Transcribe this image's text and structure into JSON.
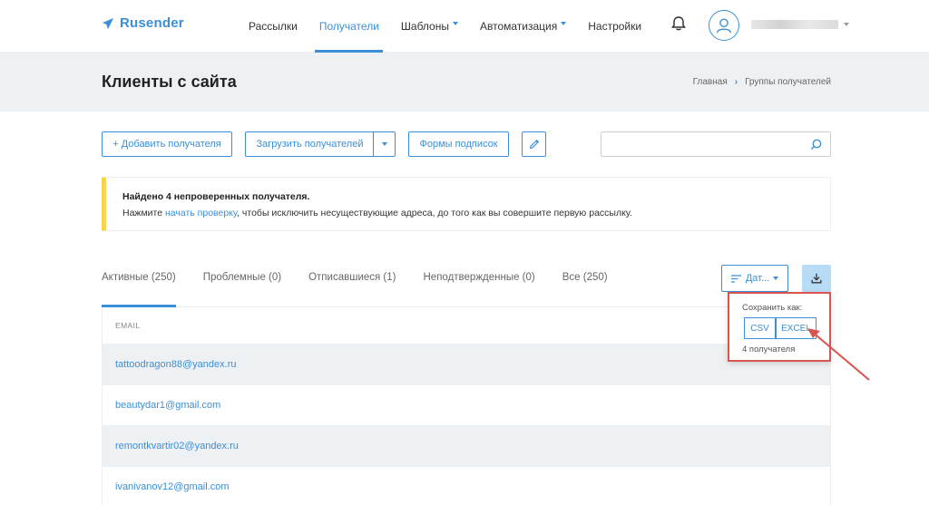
{
  "brand": {
    "name": "Rusender",
    "accent": "#3b8fd9"
  },
  "nav": {
    "items": [
      {
        "label": "Рассылки",
        "active": false,
        "dropdown": false
      },
      {
        "label": "Получатели",
        "active": true,
        "dropdown": false
      },
      {
        "label": "Шаблоны",
        "active": false,
        "dropdown": true
      },
      {
        "label": "Автоматизация",
        "active": false,
        "dropdown": true
      },
      {
        "label": "Настройки",
        "active": false,
        "dropdown": false
      }
    ]
  },
  "header": {
    "title": "Клиенты с сайта",
    "breadcrumb": [
      "Главная",
      "Группы получателей"
    ]
  },
  "toolbar": {
    "add_label": "+ Добавить получателя",
    "upload_label": "Загрузить получателей",
    "forms_label": "Формы подписок",
    "search_placeholder": ""
  },
  "notice": {
    "title": "Найдено 4 непроверенных получателя.",
    "text_before": "Нажмите ",
    "link_text": "начать проверку",
    "text_after": ", чтобы исключить несуществующие адреса, до того как вы совершите первую рассылку.",
    "color": "#f9d34c"
  },
  "tabs": [
    {
      "label": "Активные (250)",
      "active": true
    },
    {
      "label": "Проблемные (0)",
      "active": false
    },
    {
      "label": "Отписавшиеся (1)",
      "active": false
    },
    {
      "label": "Неподтвержденные (0)",
      "active": false
    },
    {
      "label": "Все (250)",
      "active": false
    }
  ],
  "sort": {
    "label": "Дат..."
  },
  "table": {
    "column_header": "EMAIL",
    "rows": [
      "tattoodragon88@yandex.ru",
      "beautydar1@gmail.com",
      "remontkvartir02@yandex.ru",
      "ivanivanov12@gmail.com"
    ]
  },
  "export_popup": {
    "title": "Сохранить как:",
    "csv": "CSV",
    "excel": "EXCEL",
    "count": "4 получателя",
    "highlight_color": "#d9534f"
  }
}
